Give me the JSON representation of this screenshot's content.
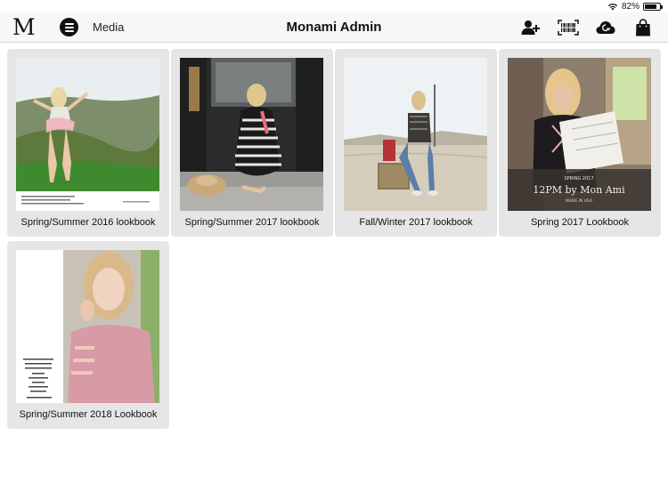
{
  "status": {
    "battery": "82%",
    "battery_level": 0.82
  },
  "nav": {
    "logo": "M",
    "media_label": "Media",
    "title": "Monami Admin",
    "icons": [
      "add-user-icon",
      "barcode-scan-icon",
      "cloud-sync-icon",
      "shopping-bag-icon"
    ]
  },
  "lookbooks": [
    {
      "title": "Spring/Summer 2016 lookbook"
    },
    {
      "title": "Spring/Summer 2017 lookbook"
    },
    {
      "title": "Fall/Winter 2017 lookbook"
    },
    {
      "title": "Spring 2017 Lookbook",
      "cover_text": "12PM by Mon Ami",
      "cover_subtext": "MADE IN USA",
      "cover_season": "SPRING 2017"
    },
    {
      "title": "Spring/Summer 2018 Lookbook"
    }
  ],
  "colors": {
    "card_bg": "#e6e6e6",
    "nav_bg": "#f7f7f7",
    "text": "#111111"
  }
}
